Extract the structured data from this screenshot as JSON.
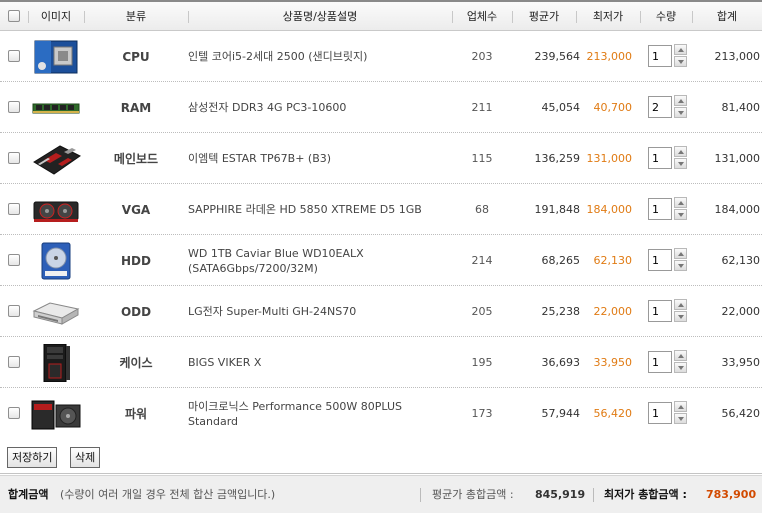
{
  "header": {
    "image": "이미지",
    "category": "분류",
    "product": "상품명/상품설명",
    "vendors": "업체수",
    "avg_price": "평균가",
    "min_price": "최저가",
    "qty": "수량",
    "total": "합계"
  },
  "rows": [
    {
      "category": "CPU",
      "name": "인텔 코어i5-2세대 2500 (샌디브릿지)",
      "name2": "",
      "vendors": "203",
      "avg": "239,564",
      "min": "213,000",
      "qty": "1",
      "total": "213,000",
      "icon": "cpu-box-image"
    },
    {
      "category": "RAM",
      "name": "삼성전자 DDR3 4G PC3-10600",
      "name2": "",
      "vendors": "211",
      "avg": "45,054",
      "min": "40,700",
      "qty": "2",
      "total": "81,400",
      "icon": "ram-module-image"
    },
    {
      "category": "메인보드",
      "name": "이엠텍 ESTAR TP67B+ (B3)",
      "name2": "",
      "vendors": "115",
      "avg": "136,259",
      "min": "131,000",
      "qty": "1",
      "total": "131,000",
      "icon": "motherboard-image"
    },
    {
      "category": "VGA",
      "name": "SAPPHIRE 라데온 HD 5850 XTREME D5 1GB",
      "name2": "",
      "vendors": "68",
      "avg": "191,848",
      "min": "184,000",
      "qty": "1",
      "total": "184,000",
      "icon": "graphics-card-image"
    },
    {
      "category": "HDD",
      "name": "WD 1TB Caviar Blue WD10EALX",
      "name2": "(SATA6Gbps/7200/32M)",
      "vendors": "214",
      "avg": "68,265",
      "min": "62,130",
      "qty": "1",
      "total": "62,130",
      "icon": "hard-drive-image"
    },
    {
      "category": "ODD",
      "name": "LG전자 Super-Multi GH-24NS70",
      "name2": "",
      "vendors": "205",
      "avg": "25,238",
      "min": "22,000",
      "qty": "1",
      "total": "22,000",
      "icon": "optical-drive-image"
    },
    {
      "category": "케이스",
      "name": "BIGS VIKER X",
      "name2": "",
      "vendors": "195",
      "avg": "36,693",
      "min": "33,950",
      "qty": "1",
      "total": "33,950",
      "icon": "pc-case-image"
    },
    {
      "category": "파워",
      "name": "마이크로닉스 Performance 500W 80PLUS",
      "name2": "Standard",
      "vendors": "173",
      "avg": "57,944",
      "min": "56,420",
      "qty": "1",
      "total": "56,420",
      "icon": "power-supply-image"
    }
  ],
  "buttons": {
    "save": "저장하기",
    "delete": "삭제"
  },
  "footer": {
    "total_label": "합계금액",
    "total_note": "(수량이 여러 개일 경우 전체 합산 금액입니다.)",
    "avg_total_label": "평균가 총합금액 :",
    "avg_total_value": "845,919",
    "min_total_label": "최저가 총합금액 :",
    "min_total_value": "783,900"
  },
  "colors": {
    "min_price": "#e07b14",
    "min_total": "#d24a00"
  }
}
